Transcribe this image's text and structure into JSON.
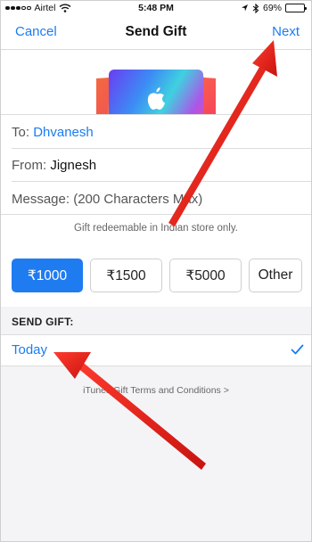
{
  "status_bar": {
    "carrier": "Airtel",
    "time": "5:48 PM",
    "battery": "69%",
    "battery_level": 0.69
  },
  "nav": {
    "cancel": "Cancel",
    "title": "Send Gift",
    "next": "Next"
  },
  "form": {
    "to_label": "To:",
    "to_value": "Dhvanesh",
    "from_label": "From:",
    "from_value": "Jignesh",
    "message_placeholder": "Message: (200 Characters Max)"
  },
  "note": "Gift redeemable in Indian store only.",
  "amounts": [
    {
      "label": "₹1000",
      "selected": true
    },
    {
      "label": "₹1500",
      "selected": false
    },
    {
      "label": "₹5000",
      "selected": false
    },
    {
      "label": "Other",
      "selected": false
    }
  ],
  "send_gift": {
    "header": "SEND GIFT:",
    "option": "Today",
    "checked": true
  },
  "terms": "iTunes Gift Terms and Conditions >",
  "colors": {
    "accent": "#1a7cf3",
    "selected_bg": "#1f7bf0",
    "arrow": "#e2231a"
  }
}
